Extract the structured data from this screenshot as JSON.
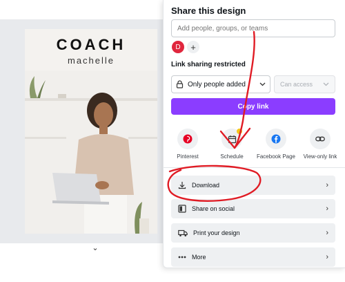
{
  "design": {
    "title": "COACH",
    "subtitle": "machelle"
  },
  "share_panel": {
    "title": "Share this design",
    "people_placeholder": "Add people, groups, or teams",
    "avatar_initial": "D",
    "add_person_symbol": "+",
    "link_sharing_label": "Link sharing restricted",
    "access_value": "Only people added",
    "permission_placeholder": "Can access",
    "copy_link_label": "Copy link",
    "share_options": [
      {
        "label": "Pinterest",
        "icon": "pinterest-icon",
        "color": "#e60023"
      },
      {
        "label": "Schedule",
        "icon": "calendar-icon",
        "color": "#333333",
        "badge_color": "#f5c518"
      },
      {
        "label": "Facebook Page",
        "icon": "facebook-icon",
        "color": "#1877f2"
      },
      {
        "label": "View-only link",
        "icon": "link-icon",
        "color": "#333333"
      }
    ],
    "actions": [
      {
        "label": "Download",
        "icon": "download-icon"
      },
      {
        "label": "Share on social",
        "icon": "share-social-icon"
      },
      {
        "label": "Print your design",
        "icon": "truck-icon"
      },
      {
        "label": "More",
        "icon": "more-icon"
      }
    ],
    "chevron": "›"
  },
  "colors": {
    "accent": "#8b3dff",
    "annotation": "#e01b24",
    "avatar": "#e0263d"
  },
  "bottom": {
    "collapse_symbol": "⌄"
  }
}
